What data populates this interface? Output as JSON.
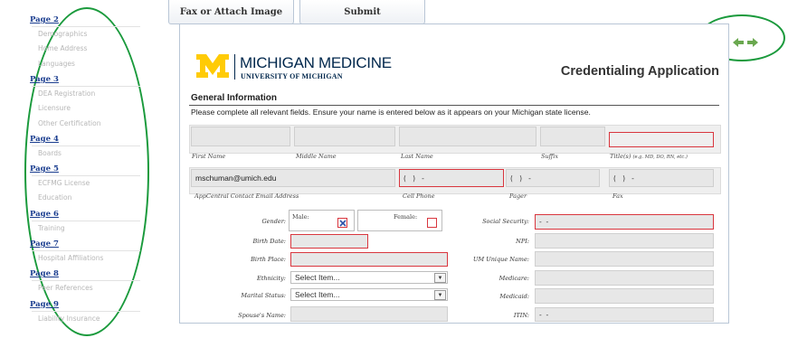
{
  "tabs": {
    "fax": "Fax or Attach Image",
    "submit": "Submit"
  },
  "sidebar": [
    {
      "page": "Page 2",
      "items": [
        "Demographics",
        "Home Address",
        "Languages"
      ]
    },
    {
      "page": "Page 3",
      "items": [
        "DEA Registration",
        "Licensure",
        "Other Certification"
      ]
    },
    {
      "page": "Page 4",
      "items": [
        "Boards"
      ]
    },
    {
      "page": "Page 5",
      "items": [
        "ECFMG License",
        "Education"
      ]
    },
    {
      "page": "Page 6",
      "items": [
        "Training"
      ]
    },
    {
      "page": "Page 7",
      "items": [
        "Hospital Affiliations"
      ]
    },
    {
      "page": "Page 8",
      "items": [
        "Peer References"
      ]
    },
    {
      "page": "Page 9",
      "items": [
        "Liability Insurance"
      ]
    }
  ],
  "header": {
    "org_main": "MICHIGAN MEDICINE",
    "org_sub": "UNIVERSITY OF MICHIGAN",
    "title": "Credentialing Application",
    "section": "General Information",
    "instructions": "Please complete all relevant fields.  Ensure your name is entered below as it appears on your Michigan state license."
  },
  "nav": {
    "back": "back-arrow-icon",
    "forward": "forward-arrow-icon"
  },
  "name_labels": {
    "first": "First Name",
    "middle": "Middle Name",
    "last": "Last Name",
    "suffix": "Suffix",
    "title": "Title(s)",
    "title_hint": "(e.g. MD, DO, RN, etc.)"
  },
  "contact": {
    "email": "mschuman@umich.edu",
    "email_label": "AppCentral Contact Email Address",
    "cell": "(   )   -",
    "cell_label": "Cell Phone",
    "pager": "(   )   -",
    "pager_label": "Pager",
    "fax": "(   )   -",
    "fax_label": "Fax"
  },
  "demo": {
    "gender_label": "Gender:",
    "male": "Male:",
    "female": "Female:",
    "birth_date": "Birth Date:",
    "birth_place": "Birth Place:",
    "ethnicity": "Ethnicity:",
    "ethnicity_value": "Select Item...",
    "marital": "Marital Status:",
    "marital_value": "Select Item...",
    "spouse": "Spouse's Name:",
    "ssn": "Social Security:",
    "ssn_value": "-  -",
    "npi": "NPI:",
    "um_unique": "UM Unique Name:",
    "medicare": "Medicare:",
    "medicaid": "Medicaid:",
    "itin": "ITIN:",
    "itin_value": "-  -"
  },
  "colors": {
    "accent_red": "#d9363e",
    "um_maize": "#ffcb05",
    "um_blue": "#00274c",
    "annotation_green": "#1a9a3c",
    "arrow_green": "#6aa84f"
  }
}
